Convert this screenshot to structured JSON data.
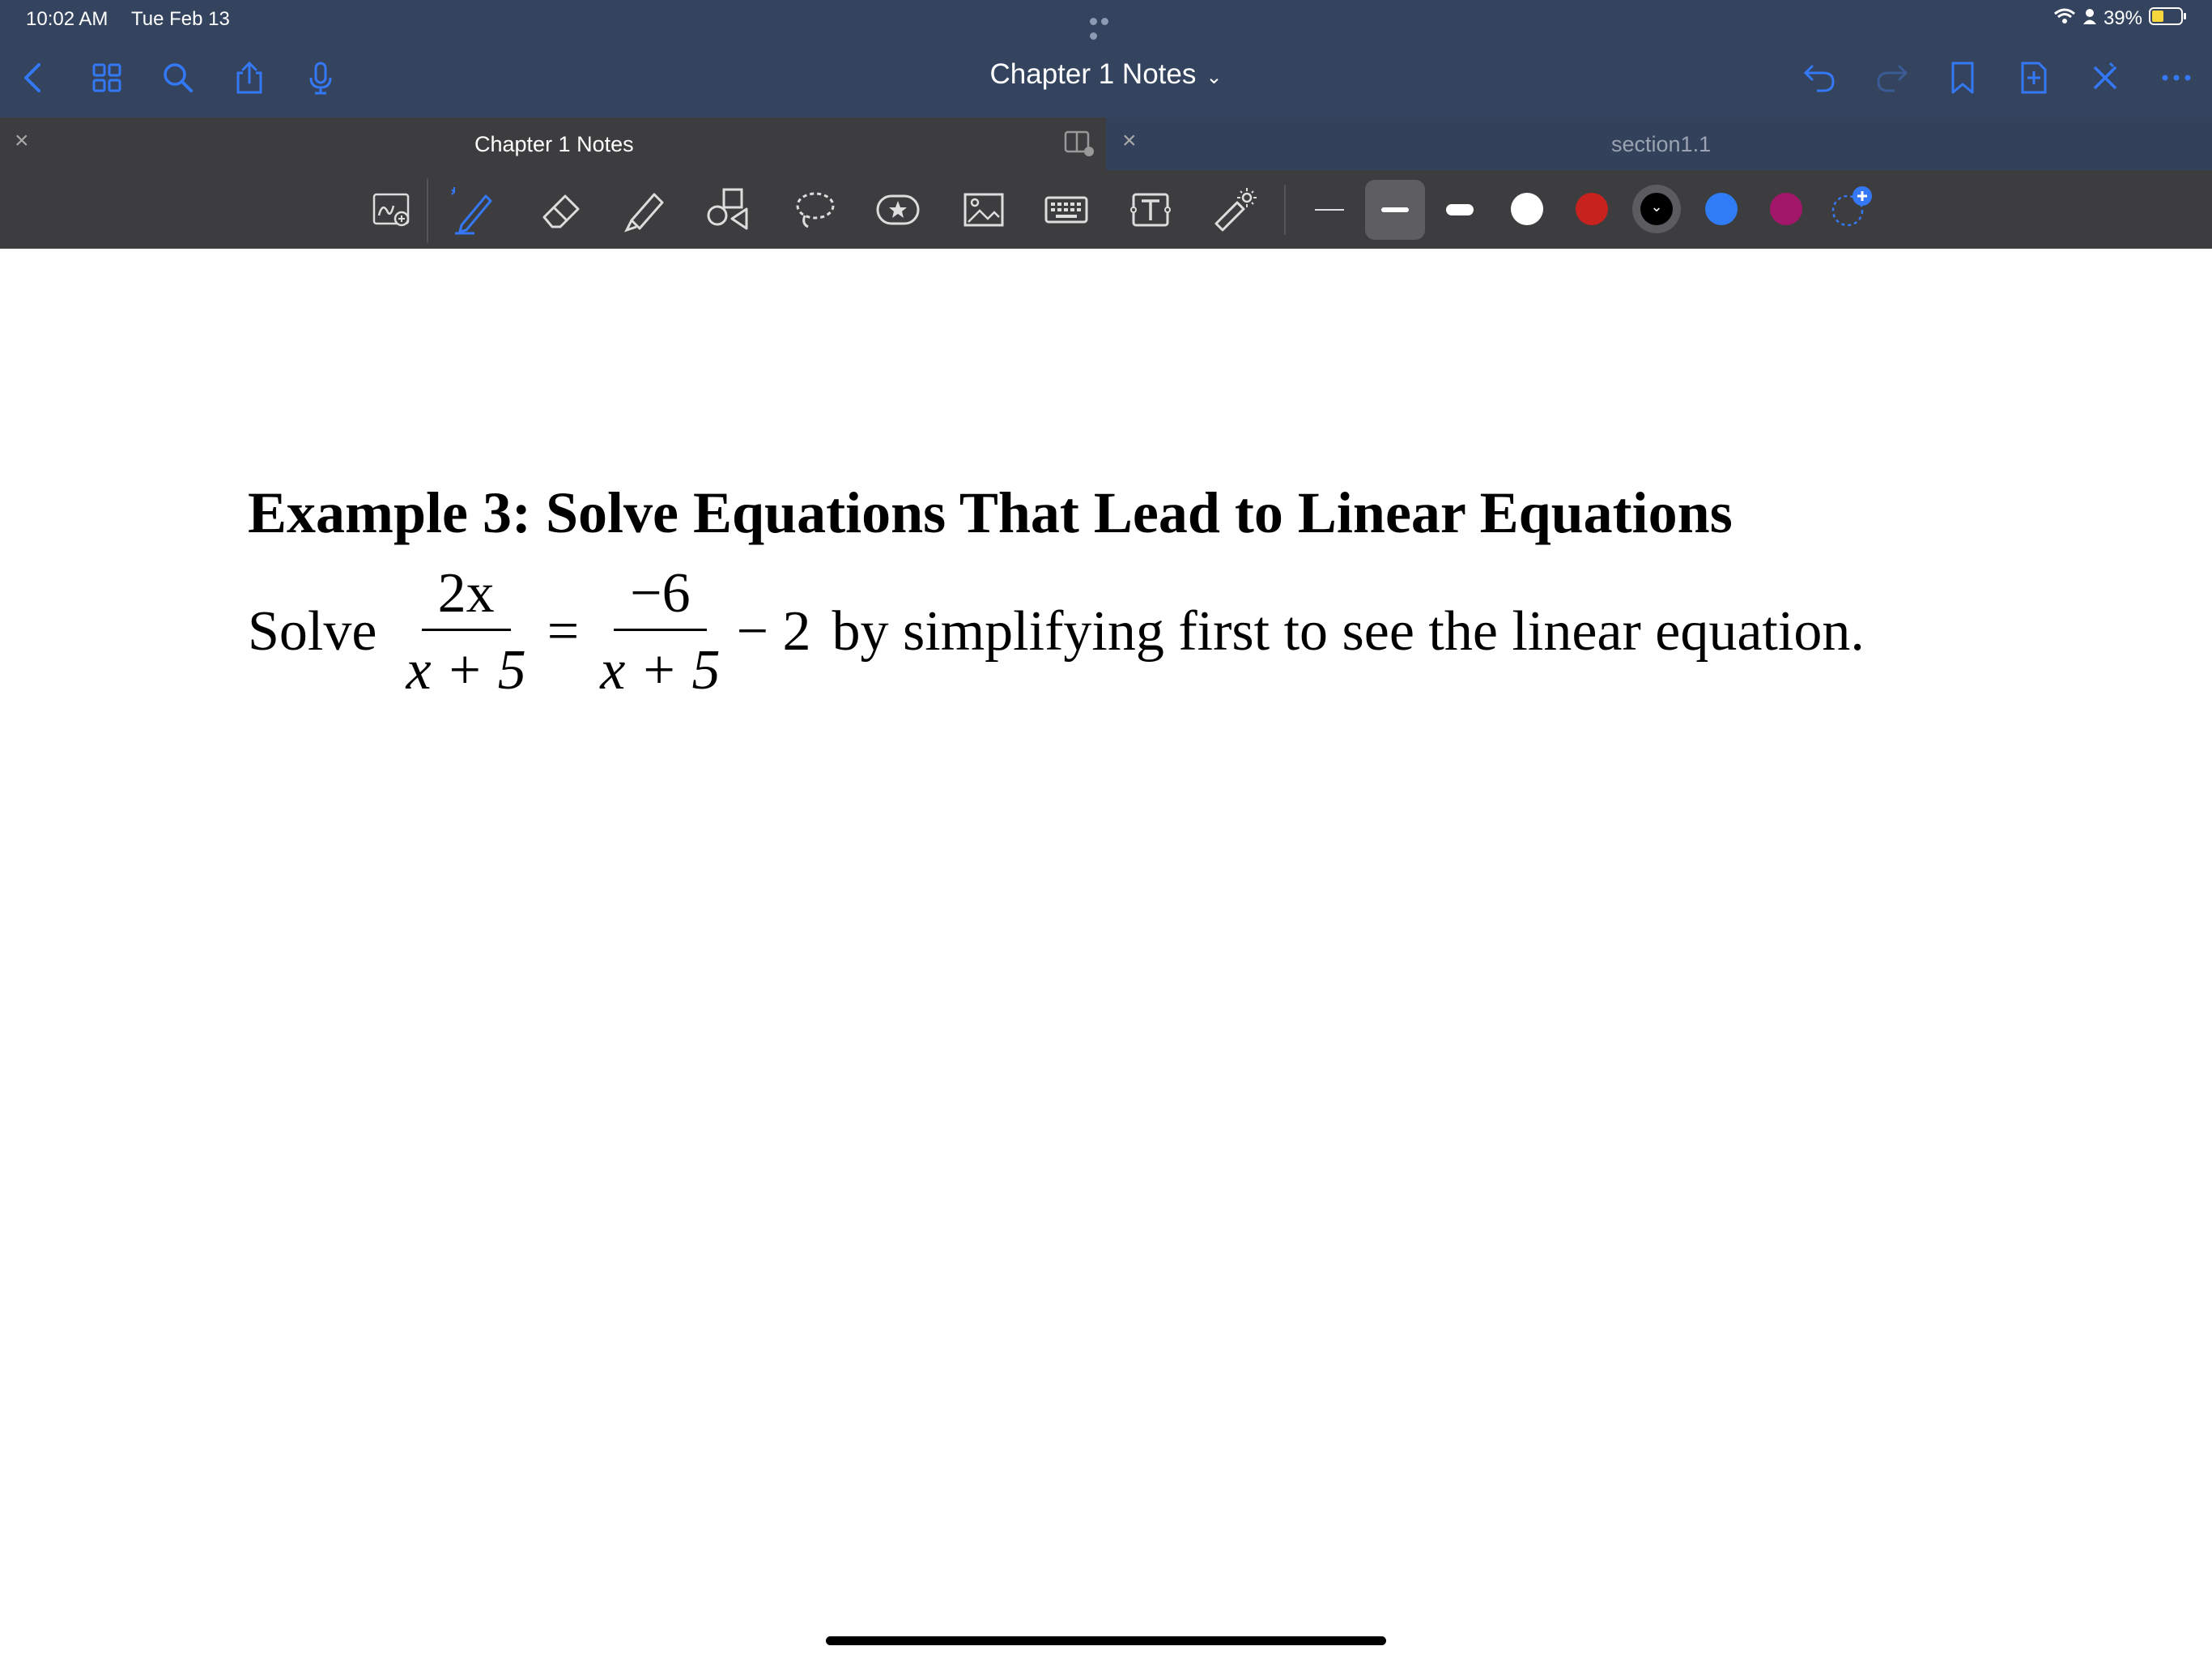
{
  "status_bar": {
    "time": "10:02 AM",
    "date": "Tue Feb 13",
    "battery": "39%"
  },
  "nav": {
    "document_title": "Chapter 1 Notes"
  },
  "tabs": [
    {
      "title": "Chapter 1 Notes",
      "active": true
    },
    {
      "title": "section1.1",
      "active": false
    }
  ],
  "toolbar": {
    "tools": [
      "zoom-window-icon",
      "pen-icon",
      "eraser-icon",
      "highlighter-icon",
      "shapes-icon",
      "lasso-icon",
      "elements-icon",
      "image-icon",
      "keyboard-icon",
      "text-box-icon",
      "laser-pointer-icon"
    ],
    "selected_tool": "pen-icon",
    "stroke_widths": [
      "thin",
      "medium",
      "thick"
    ],
    "selected_stroke": "medium",
    "colors": [
      "#ffffff",
      "#c8221e",
      "#000000",
      "#2f7cf6",
      "#a3176a"
    ],
    "selected_color": "#000000"
  },
  "page": {
    "heading": "Example 3: Solve Equations That Lead to Linear Equations",
    "problem": {
      "prefix": "Solve",
      "frac1_num": "2x",
      "frac1_den": "x + 5",
      "equals": "=",
      "frac2_num": "−6",
      "frac2_den": "x + 5",
      "tail": "− 2",
      "suffix": "by simplifying first to see the linear equation."
    }
  },
  "accent_color": "#3478f6",
  "header_color": "#34445e"
}
